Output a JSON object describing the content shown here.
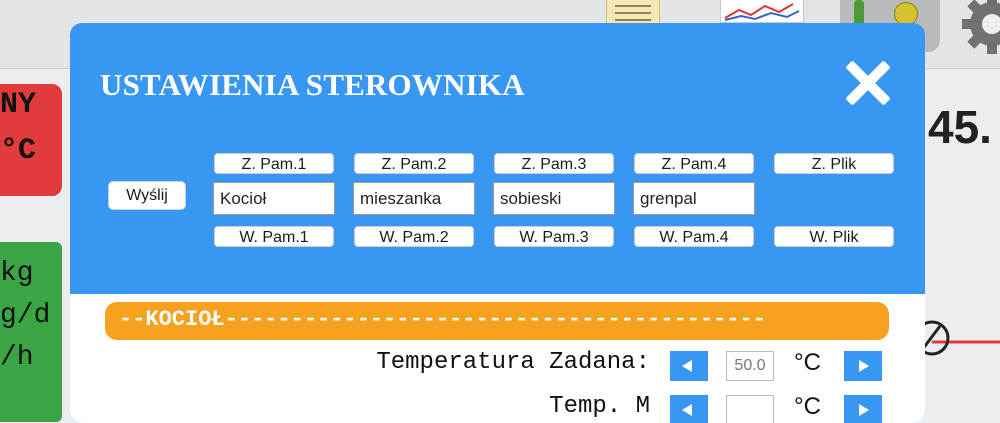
{
  "background": {
    "red_panel_lines": [
      "NY",
      "°C"
    ],
    "green_panel_lines": [
      "kg",
      "g/d",
      "/h"
    ],
    "big_value": "45."
  },
  "modal": {
    "title": "USTAWIENIA STEROWNIKA",
    "send_label": "Wyślij",
    "slots": [
      {
        "load_label": "Z. Pam.1",
        "name_value": "Kocioł",
        "save_label": "W. Pam.1"
      },
      {
        "load_label": "Z. Pam.2",
        "name_value": "mieszanka",
        "save_label": "W. Pam.2"
      },
      {
        "load_label": "Z. Pam.3",
        "name_value": "sobieski",
        "save_label": "W. Pam.3"
      },
      {
        "load_label": "Z. Pam.4",
        "name_value": "grenpal",
        "save_label": "W. Pam.4"
      }
    ],
    "file": {
      "load_label": "Z. Plik",
      "save_label": "W. Plik"
    },
    "section_title": "--KOCIOŁ-----------------------------------------",
    "rows": [
      {
        "label": "Temperatura Zadana:",
        "value": "50.0",
        "unit": "°C"
      },
      {
        "label": "Temp. M",
        "value": "",
        "unit": "°C"
      }
    ]
  },
  "colors": {
    "modal_bg": "#3897f0",
    "section_bar": "#f6a21f",
    "background_red": "#e23b3b",
    "background_green": "#3aa545"
  }
}
